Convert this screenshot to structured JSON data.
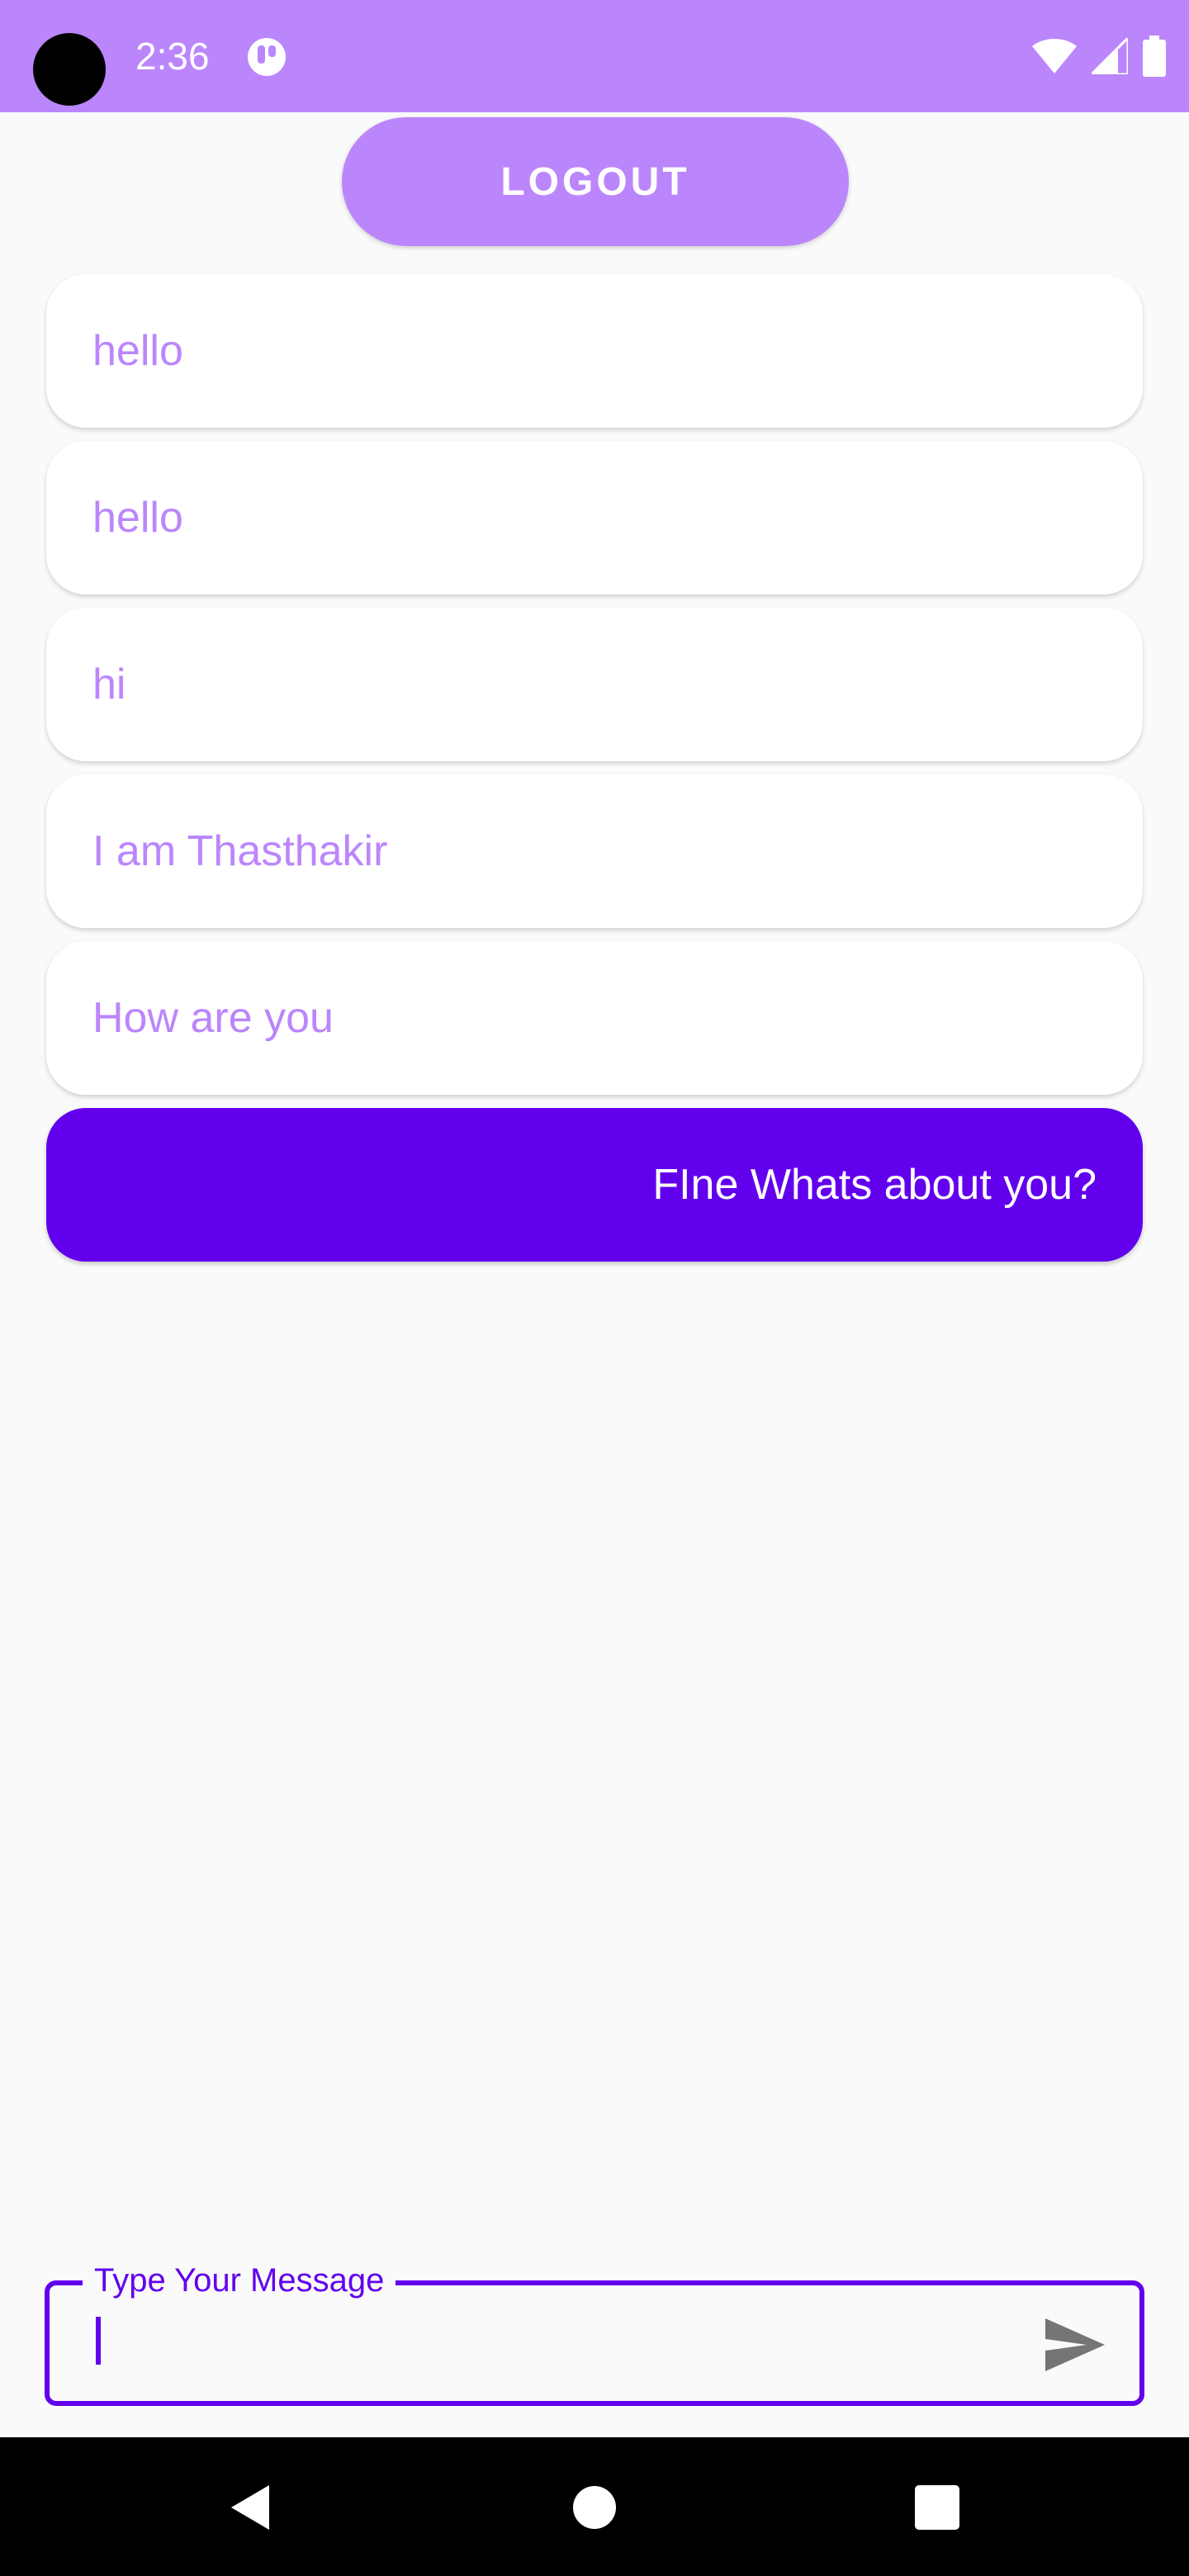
{
  "status_bar": {
    "time": "2:36",
    "icons": [
      "app-notification-icon",
      "wifi-icon",
      "signal-icon",
      "battery-icon"
    ]
  },
  "header": {
    "logout_label": "LOGOUT"
  },
  "messages": [
    {
      "text": "hello",
      "direction": "received"
    },
    {
      "text": "hello",
      "direction": "received"
    },
    {
      "text": "hi",
      "direction": "received"
    },
    {
      "text": "I am Thasthakir",
      "direction": "received"
    },
    {
      "text": "How are you",
      "direction": "received"
    },
    {
      "text": "FIne Whats about you?",
      "direction": "sent"
    }
  ],
  "composer": {
    "label": "Type Your Message",
    "value": "",
    "send_icon": "send-icon"
  },
  "nav_bar": {
    "icons": [
      "back-icon",
      "home-icon",
      "recents-icon"
    ]
  },
  "colors": {
    "primary_light": "#bb86fc",
    "primary": "#6200ee",
    "background": "#fafafa",
    "bubble_received": "#ffffff"
  }
}
